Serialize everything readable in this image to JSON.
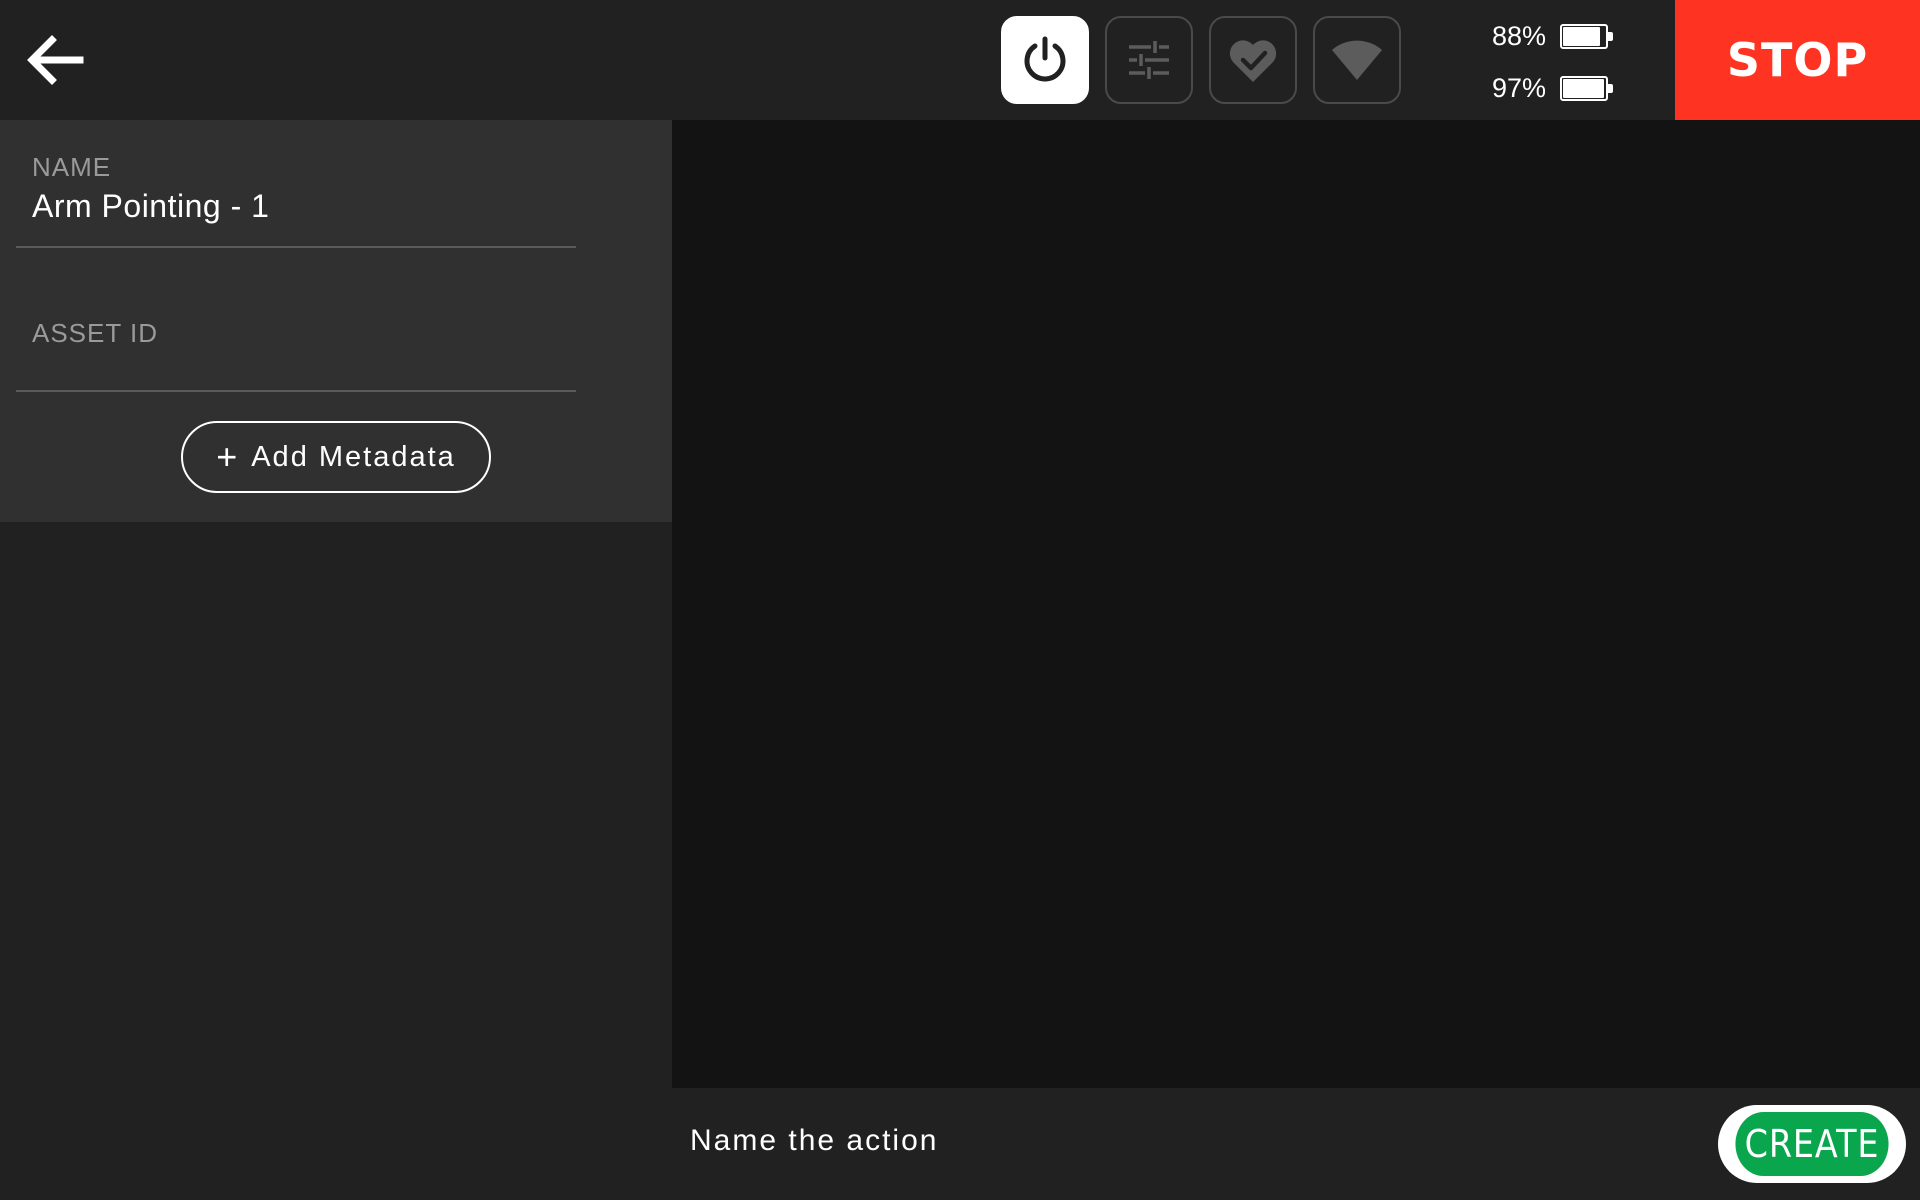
{
  "header": {
    "back_icon": "arrow-left-icon",
    "status_buttons": [
      {
        "icon": "power-icon",
        "active": true
      },
      {
        "icon": "sliders-icon",
        "active": false
      },
      {
        "icon": "heart-check-icon",
        "active": false
      },
      {
        "icon": "wifi-icon",
        "active": false
      }
    ],
    "batteries": [
      {
        "label": "88%",
        "level": 0.88
      },
      {
        "label": "97%",
        "level": 0.97
      }
    ],
    "stop_label": "STOP"
  },
  "form": {
    "name_label": "NAME",
    "name_value": "Arm Pointing - 1",
    "asset_id_label": "ASSET ID",
    "asset_id_value": "",
    "add_metadata_label": "Add Metadata"
  },
  "footer": {
    "prompt": "Name the action",
    "create_label": "CREATE"
  },
  "colors": {
    "background": "#212121",
    "panel": "#303030",
    "viewport": "#131313",
    "stop": "#ff3322",
    "create": "#0aa64e"
  }
}
